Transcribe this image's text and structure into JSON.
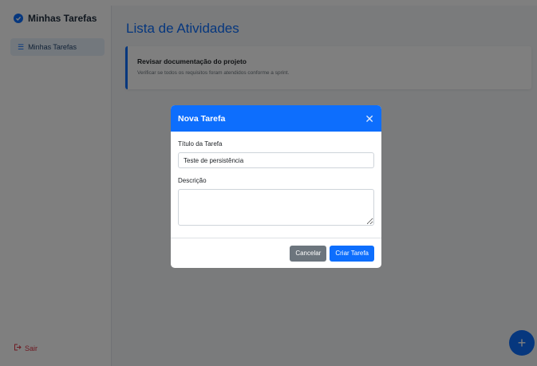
{
  "sidebar": {
    "brand": "Minhas Tarefas",
    "nav_items": [
      {
        "label": "Minhas Tarefas",
        "icon": "list-icon",
        "active": true
      }
    ],
    "logout_label": "Sair",
    "logout_icon": "logout-icon"
  },
  "main": {
    "title": "Lista de Atividades",
    "tasks": [
      {
        "title": "Revisar documentação do projeto",
        "description": "Verificar se todos os requisitos foram atendidos conforme a sprint."
      }
    ],
    "fab_icon": "plus-icon"
  },
  "modal": {
    "title": "Nova Tarefa",
    "title_label": "Título da Tarefa",
    "title_value": "Teste de persistência",
    "description_label": "Descrição",
    "description_value": "",
    "cancel_label": "Cancelar",
    "create_label": "Criar Tarefa"
  },
  "colors": {
    "primary": "#0d6efd",
    "secondary": "#6c757d",
    "danger": "#dc3545",
    "overlay": "rgba(0,0,0,0.5)"
  }
}
